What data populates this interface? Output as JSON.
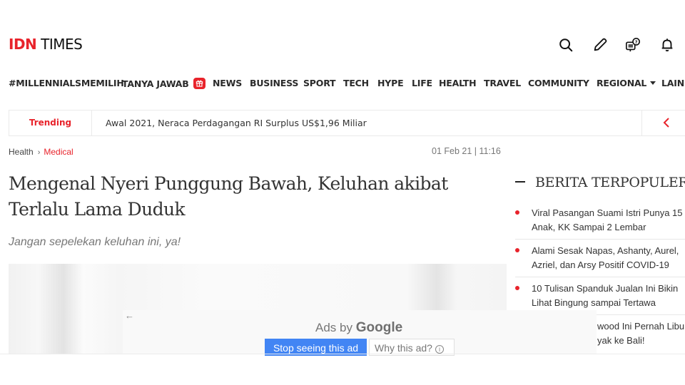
{
  "brand": {
    "logo_primary": "IDN",
    "logo_secondary": "TIMES",
    "accent_color": "#e8232b"
  },
  "header_icons": [
    "search-icon",
    "pencil-icon",
    "chat-question-icon",
    "bell-icon"
  ],
  "nav": {
    "items": [
      {
        "label": "#MILLENNIALSMEMILIH"
      },
      {
        "label": "TANYA JAWAB",
        "badge": "gift-icon"
      },
      {
        "label": "NEWS"
      },
      {
        "label": "BUSINESS"
      },
      {
        "label": "SPORT"
      },
      {
        "label": "TECH"
      },
      {
        "label": "HYPE"
      },
      {
        "label": "LIFE"
      },
      {
        "label": "HEALTH"
      },
      {
        "label": "TRAVEL"
      },
      {
        "label": "COMMUNITY"
      },
      {
        "label": "REGIONAL",
        "dropdown": true
      },
      {
        "label": "LAINNYA"
      }
    ]
  },
  "trending": {
    "label": "Trending",
    "headline": "Awal 2021, Neraca Perdagangan RI Surplus US$1,96 Miliar"
  },
  "breadcrumb": {
    "parent": "Health",
    "separator": "›",
    "current": "Medical"
  },
  "article": {
    "date": "01 Feb 21 | 11:16",
    "title": "Mengenal Nyeri Punggung Bawah, Keluhan akibat Terlalu Lama Duduk",
    "subtitle": "Jangan sepelekan keluhan ini, ya!"
  },
  "ad": {
    "back_icon": "←",
    "ads_by": "Ads by",
    "provider": "Google",
    "stop_label": "Stop seeing this ad",
    "why_label": "Why this ad?",
    "info_glyph": "i"
  },
  "sidebar": {
    "title": "BERITA TERPOPULER",
    "items": [
      {
        "line1": "Viral Pasangan Suami Istri Punya 15",
        "line2": "Anak, KK Sampai 2 Lembar"
      },
      {
        "line1": "Alami Sesak Napas, Ashanty, Aurel,",
        "line2": "Azriel, dan Arsy Positif COVID-19"
      },
      {
        "line1": "10 Tulisan Spanduk Jualan Ini Bikin",
        "line2": "Lihat Bingung sampai Tertawa"
      },
      {
        "line1": "wood Ini Pernah Libur",
        "line2": "yak ke Bali!"
      }
    ]
  }
}
